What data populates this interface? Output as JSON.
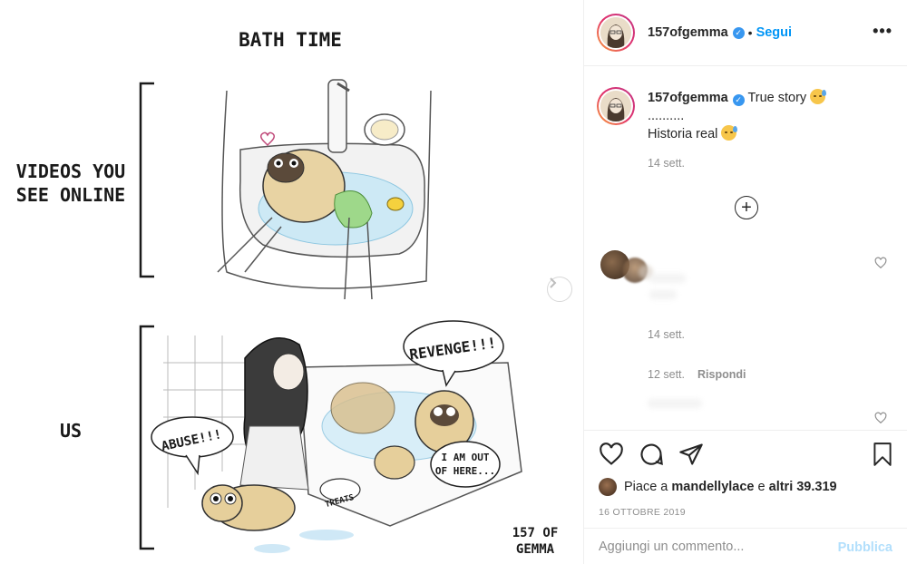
{
  "post": {
    "username": "157ofgemma",
    "follow_label": "Segui",
    "more_label": "•••"
  },
  "illustration": {
    "title": "BATH TIME",
    "top_label_line1": "VIDEOS YOU",
    "top_label_line2": "SEE ONLINE",
    "bottom_label": "US",
    "bubble_abuse": "ABUSE!!!",
    "bubble_revenge": "REVENGE!!!",
    "bubble_out_line1": "I AM OUT",
    "bubble_out_line2": "OF HERE...",
    "treats_label": "TREATS",
    "signature_line1": "157 OF",
    "signature_line2": "GEMMA"
  },
  "caption": {
    "username": "157ofgemma",
    "line1": "True story",
    "line2": "..........",
    "line3": "Historia real",
    "time": "14 sett."
  },
  "comments": [
    {
      "time": "14 sett."
    },
    {
      "time": "12 sett.",
      "reply_label": "Rispondi"
    }
  ],
  "likes": {
    "prefix": "Piace a",
    "user": "mandellylace",
    "middle": "e",
    "others": "altri 39.319"
  },
  "date": "16 OTTOBRE 2019",
  "comment_box": {
    "placeholder": "Aggiungi un commento...",
    "publish_label": "Pubblica"
  },
  "colors": {
    "link_blue": "#0095f6",
    "publish_disabled": "#b2dffc",
    "muted": "#8e8e8e",
    "text": "#262626"
  }
}
